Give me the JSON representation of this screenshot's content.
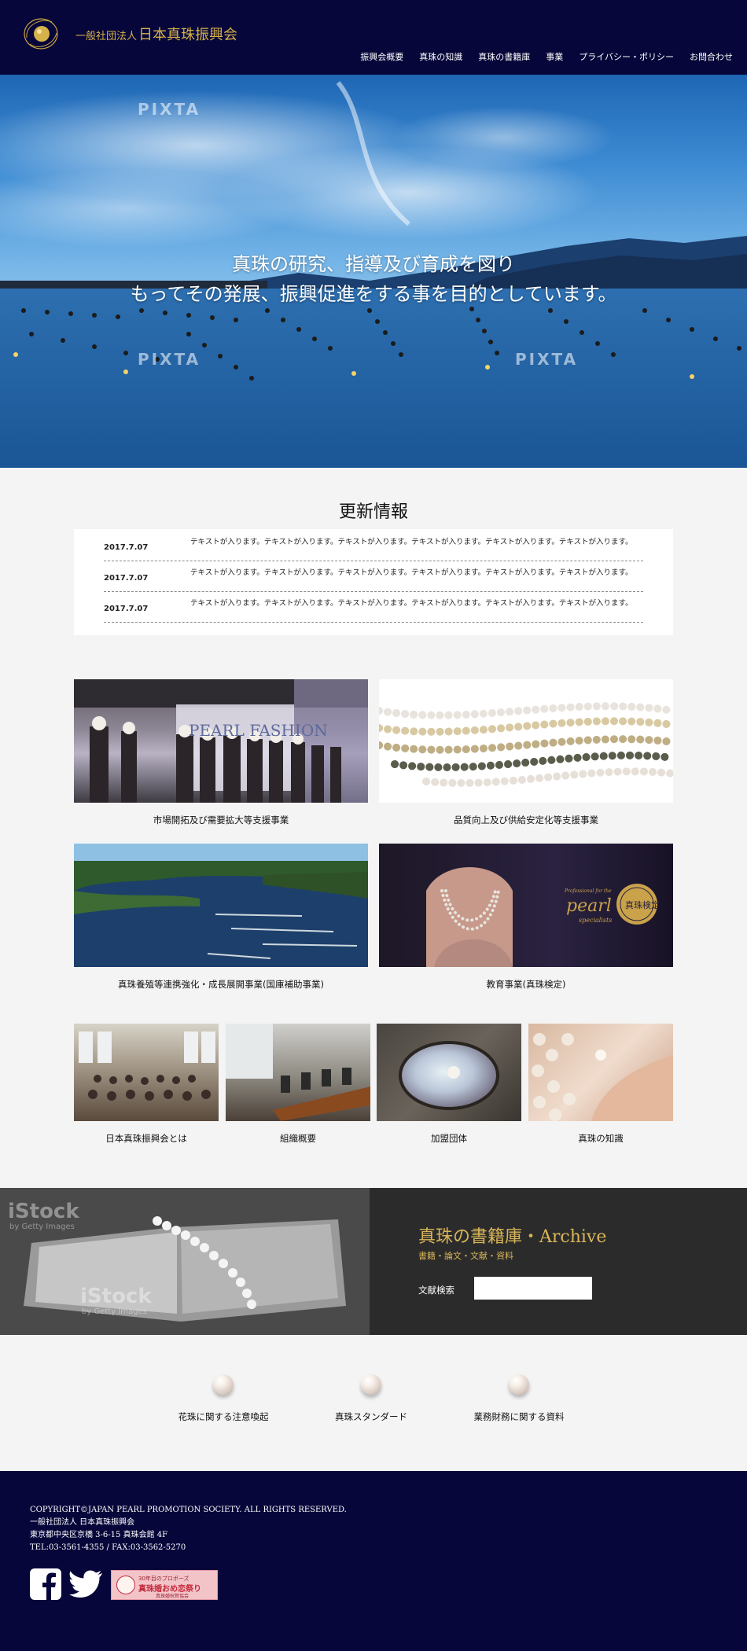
{
  "header": {
    "logo_prefix": "一般社団法人",
    "logo_name": "日本真珠振興会",
    "nav": [
      "振興会概要",
      "真珠の知識",
      "真珠の書籍庫",
      "事業",
      "プライバシー・ポリシー",
      "お問合わせ"
    ]
  },
  "hero": {
    "line1": "真珠の研究、指導及び育成を図り",
    "line2": "もってその発展、振興促進をする事を目的としています。",
    "watermark": "PIXTA"
  },
  "news": {
    "title": "更新情報",
    "items": [
      {
        "date": "2017.7.07",
        "text": "テキストが入ります。テキストが入ります。テキストが入ります。テキストが入ります。テキストが入ります。テキストが入ります。"
      },
      {
        "date": "2017.7.07",
        "text": "テキストが入ります。テキストが入ります。テキストが入ります。テキストが入ります。テキストが入ります。テキストが入ります。"
      },
      {
        "date": "2017.7.07",
        "text": "テキストが入ります。テキストが入ります。テキストが入ります。テキストが入ります。テキストが入ります。テキストが入ります。"
      }
    ]
  },
  "business": {
    "large": [
      "市場開拓及び需要拡大等支援事業",
      "品質向上及び供給安定化等支援事業",
      "真珠養殖等連携強化・成長展開事業(国庫補助事業)",
      "教育事業(真珠検定)"
    ],
    "small": [
      "日本真珠振興会とは",
      "組織概要",
      "加盟団体",
      "真珠の知識"
    ],
    "photo_text": {
      "pearl_fashion": "PEARL FASHION",
      "pearl_logo": "pearl",
      "pearl_logo_tagline": "Professional for the",
      "pearl_logo_sub": "specialists",
      "kentei": "真珠検定"
    }
  },
  "archive": {
    "title": "真珠の書籍庫・Archive",
    "subtitle": "書籍・論文・文献・資料",
    "search_label": "文献検索",
    "search_value": "",
    "watermark_main": "iStock",
    "watermark_sub": "by Getty Images"
  },
  "links": [
    "花珠に関する注意喚起",
    "真珠スタンダード",
    "業務財務に関する資料"
  ],
  "footer": {
    "copyright": "COPYRIGHT©JAPAN PEARL PROMOTION SOCIETY. ALL RIGHTS RESERVED.",
    "org": "一般社団法人 日本真珠振興会",
    "address": "東京都中央区京橋 3-6-15 真珠会館 4F",
    "tel": "TEL:03-3561-4355 / FAX:03-3562-5270",
    "banner_top": "30年目のプロポーズ",
    "banner_main": "真珠婚おめ恋祭り",
    "banner_bottom": "真珠婚祝賀協会"
  },
  "colors": {
    "navy": "#06063a",
    "gold": "#d6b24a",
    "archive_bg": "#2b2b2b",
    "page_bg": "#f4f4f4"
  }
}
